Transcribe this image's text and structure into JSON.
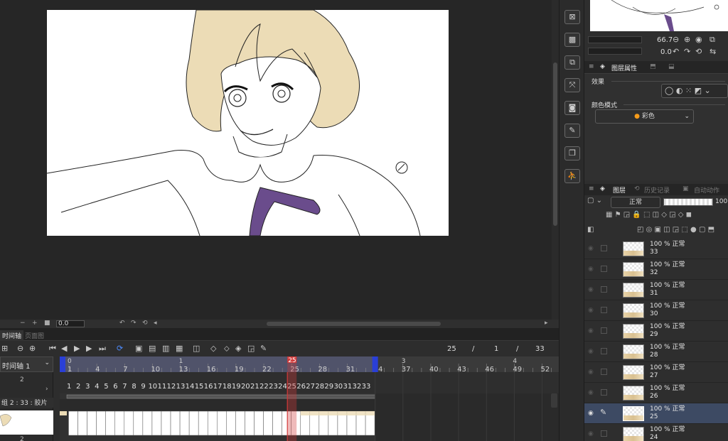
{
  "canvas": {
    "zoom_value": "0.0"
  },
  "timeline": {
    "tabs": [
      "时间轴",
      "页面图"
    ],
    "track_selector": "时间轴 1",
    "left_number_1": "2",
    "left_number_2": "2",
    "track_label": "组 2 : 33 : 胶片",
    "current_frame": "25",
    "sep1": "/",
    "start_frame": "1",
    "sep2": "/",
    "end_frame": "33",
    "ruler_sec_labels": [
      {
        "text": "0",
        "frame": 0
      },
      {
        "text": "1",
        "frame": 13
      },
      {
        "text": "2",
        "frame": 37
      },
      {
        "text": "3",
        "frame": 37
      },
      {
        "text": "4",
        "frame": 49
      }
    ],
    "ruler_frame_labels": [
      "1",
      "4",
      "7",
      "10",
      "13",
      "16",
      "19",
      "22",
      "25",
      "28",
      "31",
      "34",
      "37",
      "40",
      "43",
      "46",
      "49",
      "52"
    ],
    "cell_numbers": [
      "1",
      "2",
      "3",
      "4",
      "5",
      "6",
      "7",
      "8",
      "9",
      "10",
      "11",
      "12",
      "13",
      "14",
      "15",
      "16",
      "17",
      "18",
      "19",
      "20",
      "21",
      "22",
      "23",
      "24",
      "25",
      "26",
      "27",
      "28",
      "29",
      "30",
      "31",
      "32",
      "33"
    ],
    "playhead_label": "25",
    "sec_marker_1": "1",
    "sec_marker_3": "3",
    "sec_marker_4": "4"
  },
  "navigator": {
    "zoom": "66.7",
    "angle": "0.0"
  },
  "properties": {
    "tab_label": "图层属性",
    "effect_label": "效果",
    "color_mode_label": "颜色模式",
    "color_mode_value": "彩色"
  },
  "layers_panel": {
    "tab_layers": "图层",
    "tab_history": "历史记录",
    "tab_auto": "自动动作",
    "blend_mode": "正常",
    "opacity": "100",
    "rows": [
      {
        "line1": "100 % 正常",
        "line2": "33"
      },
      {
        "line1": "100 % 正常",
        "line2": "32"
      },
      {
        "line1": "100 % 正常",
        "line2": "31"
      },
      {
        "line1": "100 % 正常",
        "line2": "30"
      },
      {
        "line1": "100 % 正常",
        "line2": "29"
      },
      {
        "line1": "100 % 正常",
        "line2": "28"
      },
      {
        "line1": "100 % 正常",
        "line2": "27"
      },
      {
        "line1": "100 % 正常",
        "line2": "26"
      },
      {
        "line1": "100 % 正常",
        "line2": "25"
      },
      {
        "line1": "100 % 正常",
        "line2": "24"
      }
    ]
  },
  "colors": {
    "accent": "#4d8cff",
    "playhead": "#d23a3a",
    "range_marker": "#2a3fd6",
    "hair": "#ecdcb6",
    "tie": "#6a4c8c"
  }
}
